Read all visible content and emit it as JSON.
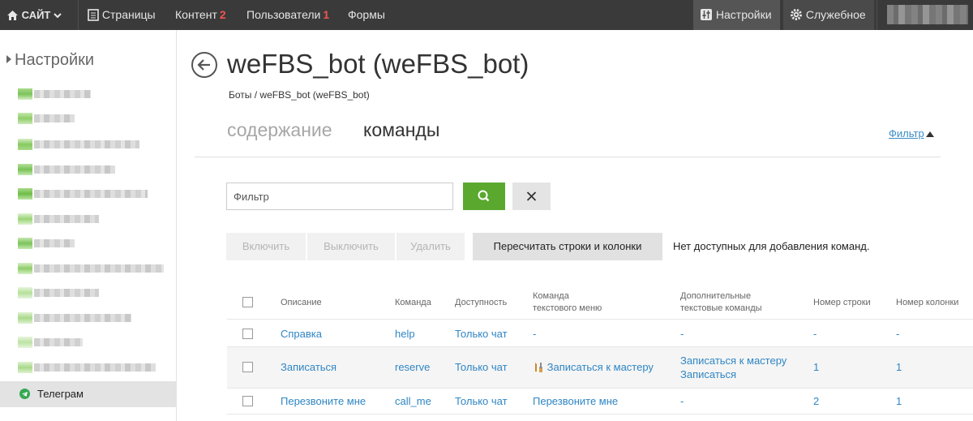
{
  "topbar": {
    "site_label": "САЙТ",
    "nav": [
      {
        "label": "Страницы",
        "count": ""
      },
      {
        "label": "Контент",
        "count": "2"
      },
      {
        "label": "Пользователи",
        "count": "1"
      },
      {
        "label": "Формы",
        "count": ""
      }
    ],
    "settings_label": "Настройки",
    "service_label": "Служебное"
  },
  "sidebar": {
    "title": "Настройки",
    "active_item": "Телеграм"
  },
  "page": {
    "title": "weFBS_bot (weFBS_bot)",
    "breadcrumb": "Боты / weFBS_bot (weFBS_bot)",
    "tabs": [
      {
        "label": "содержание",
        "active": false
      },
      {
        "label": "команды",
        "active": true
      }
    ],
    "filter_toggle": "Фильтр"
  },
  "filter": {
    "placeholder": "Фильтр",
    "value": ""
  },
  "actions": {
    "enable": "Включить",
    "disable": "Выключить",
    "delete": "Удалить",
    "recalc": "Пересчитать строки и колонки",
    "status": "Нет доступных для добавления команд."
  },
  "table": {
    "columns": [
      "Описание",
      "Команда",
      "Доступность",
      "Команда\nтекстового меню",
      "Дополнительные\nтекстовые команды",
      "Номер строки",
      "Номер колонки"
    ],
    "rows": [
      {
        "description": "Справка",
        "command": "help",
        "availability": "Только чат",
        "menu": "-",
        "extra": [
          "-"
        ],
        "row": "-",
        "col": "-"
      },
      {
        "description": "Записаться",
        "command": "reserve",
        "availability": "Только чат",
        "menu": "Записаться к мастеру",
        "menu_icon": "tools-icon",
        "extra": [
          "Записаться к мастеру",
          "Записаться"
        ],
        "row": "1",
        "col": "1"
      },
      {
        "description": "Перезвоните мне",
        "command": "call_me",
        "availability": "Только чат",
        "menu": "Перезвоните мне",
        "extra": [
          "-"
        ],
        "row": "2",
        "col": "1"
      }
    ]
  },
  "colors": {
    "topbar": "#3a3a3a",
    "accent_green": "#5ba82f",
    "link_blue": "#2f86c4",
    "badge_red": "#f0544f"
  }
}
